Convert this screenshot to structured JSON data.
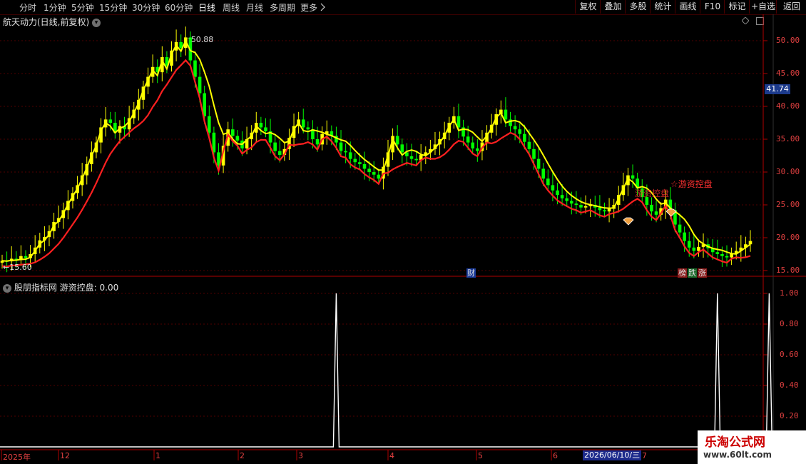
{
  "toolbar": {
    "periods": [
      "分时",
      "1分钟",
      "5分钟",
      "15分钟",
      "30分钟",
      "60分钟",
      "日线",
      "周线",
      "月线",
      "多周期",
      "更多"
    ],
    "active_period": "日线",
    "tools": [
      "复权",
      "叠加",
      "多股",
      "统计",
      "画线",
      "F10",
      "标记",
      "+自选",
      "返回"
    ]
  },
  "main": {
    "title": "航天动力(日线,前复权)",
    "high_label": "50.88",
    "low_label": "15.60",
    "current_price": "41.74",
    "y_ticks": [
      "50.00",
      "45.00",
      "40.00",
      "35.00",
      "30.00",
      "25.00",
      "20.00",
      "15.00"
    ],
    "annotation": "☆游资控盘",
    "annotation_hidden": "游资控盘",
    "badge_cai": "财",
    "badge_bang": "榜",
    "badge_die": "跌",
    "badge_zhang": "涨"
  },
  "indicator": {
    "title": "股朋指标网 游资控盘: 0.00",
    "y_ticks": [
      "1.00",
      "0.80",
      "0.60",
      "0.40",
      "0.20"
    ]
  },
  "x_axis": {
    "labels": [
      "2025年",
      "12",
      "1",
      "2",
      "3",
      "4",
      "5",
      "6",
      "7"
    ],
    "cursor_date": "2026/06/10/三"
  },
  "watermark": {
    "title": "乐淘公式网",
    "url": "www.60lt.com"
  },
  "colors": {
    "up_candle": "#ffff00",
    "down_candle": "#00ff00",
    "red_line": "#ff2020",
    "yellow_line": "#ffff00",
    "axis": "#b00000",
    "grid": "#500000"
  },
  "chart_data": {
    "type": "line",
    "y_range": [
      15,
      52
    ],
    "close": [
      16.5,
      16.4,
      16.8,
      16.6,
      17.2,
      16.9,
      17.5,
      18.5,
      19.6,
      20.1,
      21.0,
      22.4,
      23.0,
      24.2,
      25.6,
      26.8,
      28.0,
      29.5,
      31.2,
      33.0,
      34.5,
      36.8,
      38.0,
      37.5,
      36.0,
      37.0,
      36.5,
      38.2,
      39.5,
      41.0,
      43.0,
      44.5,
      46.0,
      45.2,
      47.5,
      46.2,
      48.5,
      49.8,
      48.9,
      50.5,
      47.0,
      44.5,
      42.0,
      38.5,
      36.0,
      33.0,
      31.0,
      34.0,
      36.5,
      35.5,
      34.8,
      33.6,
      35.0,
      36.0,
      37.5,
      36.8,
      36.2,
      34.5,
      33.2,
      32.6,
      33.5,
      35.2,
      37.0,
      38.0,
      36.8,
      36.5,
      35.0,
      34.2,
      35.8,
      36.2,
      35.5,
      34.5,
      33.2,
      33.0,
      32.0,
      31.5,
      31.2,
      30.5,
      30.0,
      29.6,
      29.0,
      30.8,
      33.0,
      35.5,
      34.2,
      33.0,
      32.4,
      32.0,
      31.8,
      32.6,
      33.0,
      33.5,
      34.2,
      35.0,
      36.0,
      37.5,
      38.5,
      36.8,
      35.4,
      34.5,
      33.6,
      33.2,
      34.5,
      36.0,
      37.2,
      38.8,
      39.5,
      38.0,
      37.0,
      36.5,
      35.8,
      34.6,
      33.5,
      32.0,
      30.5,
      29.0,
      28.0,
      27.2,
      26.5,
      26.0,
      25.6,
      25.2,
      25.0,
      24.6,
      24.8,
      25.0,
      24.6,
      24.2,
      24.0,
      24.4,
      25.0,
      26.5,
      28.0,
      29.5,
      29.0,
      27.5,
      26.2,
      25.0,
      24.0,
      23.5,
      24.5,
      25.8,
      24.2,
      22.0,
      20.8,
      19.5,
      18.5,
      18.0,
      18.6,
      19.0,
      18.4,
      17.8,
      17.5,
      17.2,
      17.0,
      17.6,
      18.0,
      18.5,
      19.0,
      19.5
    ]
  },
  "indicator_data": {
    "type": "line",
    "y_range": [
      0,
      1
    ],
    "spike_bars": [
      71,
      152,
      163
    ],
    "spike_value": 1.0
  }
}
